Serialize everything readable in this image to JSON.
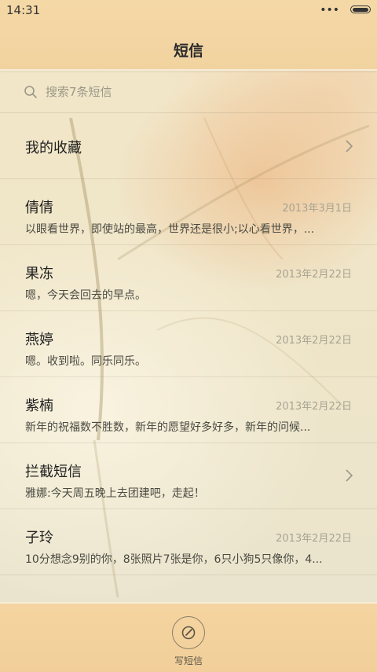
{
  "status_bar": {
    "time": "14:31",
    "dots": "•••"
  },
  "header": {
    "title": "短信"
  },
  "search": {
    "placeholder": "搜索7条短信"
  },
  "list": {
    "favorites": {
      "label": "我的收藏"
    },
    "items": [
      {
        "name": "倩倩",
        "date": "2013年3月1日",
        "preview": "以眼看世界，即使站的最高，世界还是很小;以心看世界，..."
      },
      {
        "name": "果冻",
        "date": "2013年2月22日",
        "preview": "嗯，今天会回去的早点。"
      },
      {
        "name": "燕婷",
        "date": "2013年2月22日",
        "preview": "嗯。收到啦。同乐同乐。"
      },
      {
        "name": "紫楠",
        "date": "2013年2月22日",
        "preview": "新年的祝福数不胜数，新年的愿望好多好多，新年的问候..."
      }
    ],
    "blocked": {
      "name": "拦截短信",
      "preview": "雅娜:今天周五晚上去团建吧，走起！"
    },
    "last_item": {
      "name": "子玲",
      "date": "2013年2月22日",
      "preview": "10分想念9别的你，8张照片7张是你，6只小狗5只像你，4..."
    }
  },
  "bottom": {
    "compose_label": "写短信"
  },
  "icons": {
    "search": "search-icon",
    "chevron": "chevron-right-icon",
    "compose": "compose-icon"
  },
  "colors": {
    "header_bg": "#f2d3a0",
    "bottom_bg": "#f3d29d",
    "text_primary": "#1f1f1f",
    "text_secondary": "#a8a392"
  }
}
